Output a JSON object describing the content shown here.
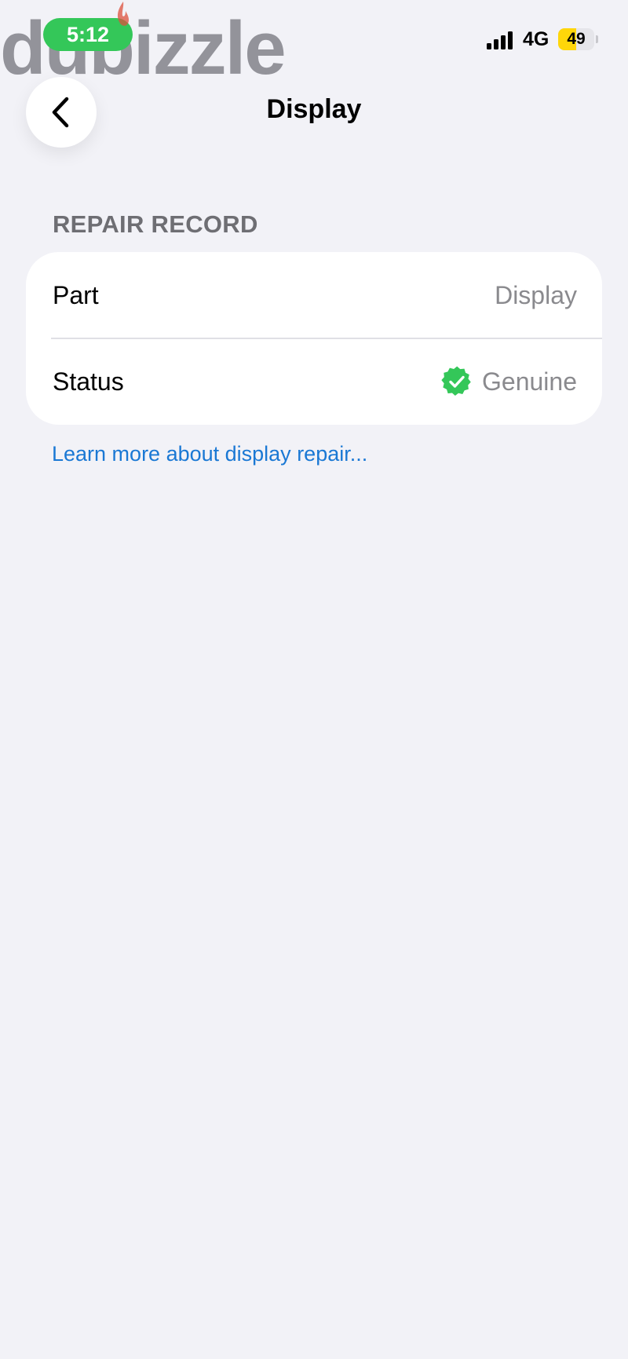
{
  "status_bar": {
    "time": "5:12",
    "network": "4G",
    "battery_level": "49",
    "battery_fraction": 0.49,
    "signal_icon": "cellular-signal-icon",
    "battery_icon": "battery-icon"
  },
  "watermark": {
    "text": "dubizzle"
  },
  "nav": {
    "back_icon": "chevron-left-icon",
    "title": "Display"
  },
  "repair_record": {
    "header": "REPAIR RECORD",
    "rows": [
      {
        "label": "Part",
        "value": "Display"
      },
      {
        "label": "Status",
        "value": "Genuine",
        "icon": "verified-check-icon"
      }
    ]
  },
  "learn_more_link": "Learn more about display repair...",
  "colors": {
    "background": "#f2f2f7",
    "accent_green": "#34c759",
    "link_blue": "#1a78d4",
    "battery_yellow": "#ffd60a"
  }
}
